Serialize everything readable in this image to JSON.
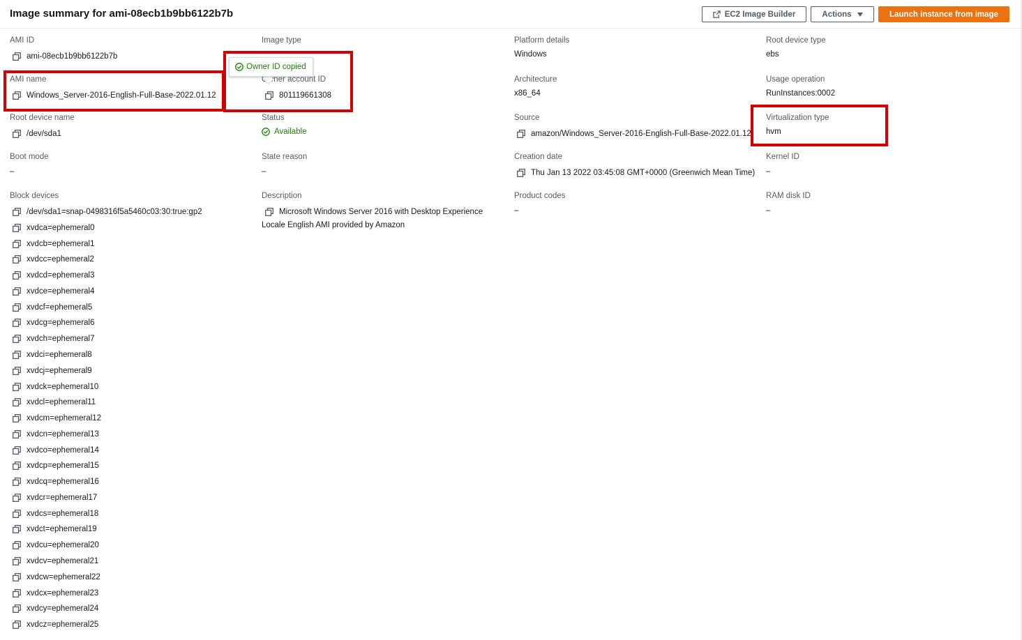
{
  "header": {
    "title": "Image summary for ami-08ecb1b9bb6122b7b",
    "image_builder_label": "EC2 Image Builder",
    "actions_label": "Actions",
    "launch_label": "Launch instance from image"
  },
  "tooltip": {
    "text": "Owner ID copied"
  },
  "fields": {
    "ami_id": {
      "label": "AMI ID",
      "value": "ami-08ecb1b9bb6122b7b"
    },
    "image_type": {
      "label": "Image type"
    },
    "platform_details": {
      "label": "Platform details",
      "value": "Windows"
    },
    "root_device_type": {
      "label": "Root device type",
      "value": "ebs"
    },
    "ami_name": {
      "label": "AMI name",
      "value": "Windows_Server-2016-English-Full-Base-2022.01.12"
    },
    "owner_account_id": {
      "label": "Owner account ID",
      "value": "801119661308"
    },
    "architecture": {
      "label": "Architecture",
      "value": "x86_64"
    },
    "usage_operation": {
      "label": "Usage operation",
      "value": "RunInstances:0002"
    },
    "root_device_name": {
      "label": "Root device name",
      "value": "/dev/sda1"
    },
    "status": {
      "label": "Status",
      "value": "Available"
    },
    "source": {
      "label": "Source",
      "value": "amazon/Windows_Server-2016-English-Full-Base-2022.01.12"
    },
    "virtualization_type": {
      "label": "Virtualization type",
      "value": "hvm"
    },
    "boot_mode": {
      "label": "Boot mode",
      "value": "–"
    },
    "state_reason": {
      "label": "State reason",
      "value": "–"
    },
    "creation_date": {
      "label": "Creation date",
      "value": "Thu Jan 13 2022 03:45:08 GMT+0000 (Greenwich Mean Time)"
    },
    "kernel_id": {
      "label": "Kernel ID",
      "value": "–"
    },
    "block_devices": {
      "label": "Block devices"
    },
    "description": {
      "label": "Description",
      "line1": "Microsoft Windows Server 2016 with Desktop Experience",
      "line2": "Locale English AMI provided by Amazon"
    },
    "product_codes": {
      "label": "Product codes",
      "value": "–"
    },
    "ram_disk_id": {
      "label": "RAM disk ID",
      "value": "–"
    }
  },
  "block_devices": [
    "/dev/sda1=snap-0498316f5a5460c03:30:true:gp2",
    "xvdca=ephemeral0",
    "xvdcb=ephemeral1",
    "xvdcc=ephemeral2",
    "xvdcd=ephemeral3",
    "xvdce=ephemeral4",
    "xvdcf=ephemeral5",
    "xvdcg=ephemeral6",
    "xvdch=ephemeral7",
    "xvdci=ephemeral8",
    "xvdcj=ephemeral9",
    "xvdck=ephemeral10",
    "xvdcl=ephemeral11",
    "xvdcm=ephemeral12",
    "xvdcn=ephemeral13",
    "xvdco=ephemeral14",
    "xvdcp=ephemeral15",
    "xvdcq=ephemeral16",
    "xvdcr=ephemeral17",
    "xvdcs=ephemeral18",
    "xvdct=ephemeral19",
    "xvdcu=ephemeral20",
    "xvdcv=ephemeral21",
    "xvdcw=ephemeral22",
    "xvdcx=ephemeral23",
    "xvdcy=ephemeral24",
    "xvdcz=ephemeral25"
  ],
  "icons": {
    "copy": "copy-icon",
    "external": "external-link-icon",
    "status_ok": "check-circle-icon",
    "caret": "caret-down-icon"
  },
  "colors": {
    "accent": "#ec7211",
    "success": "#1d8102",
    "highlight": "#d40000"
  }
}
